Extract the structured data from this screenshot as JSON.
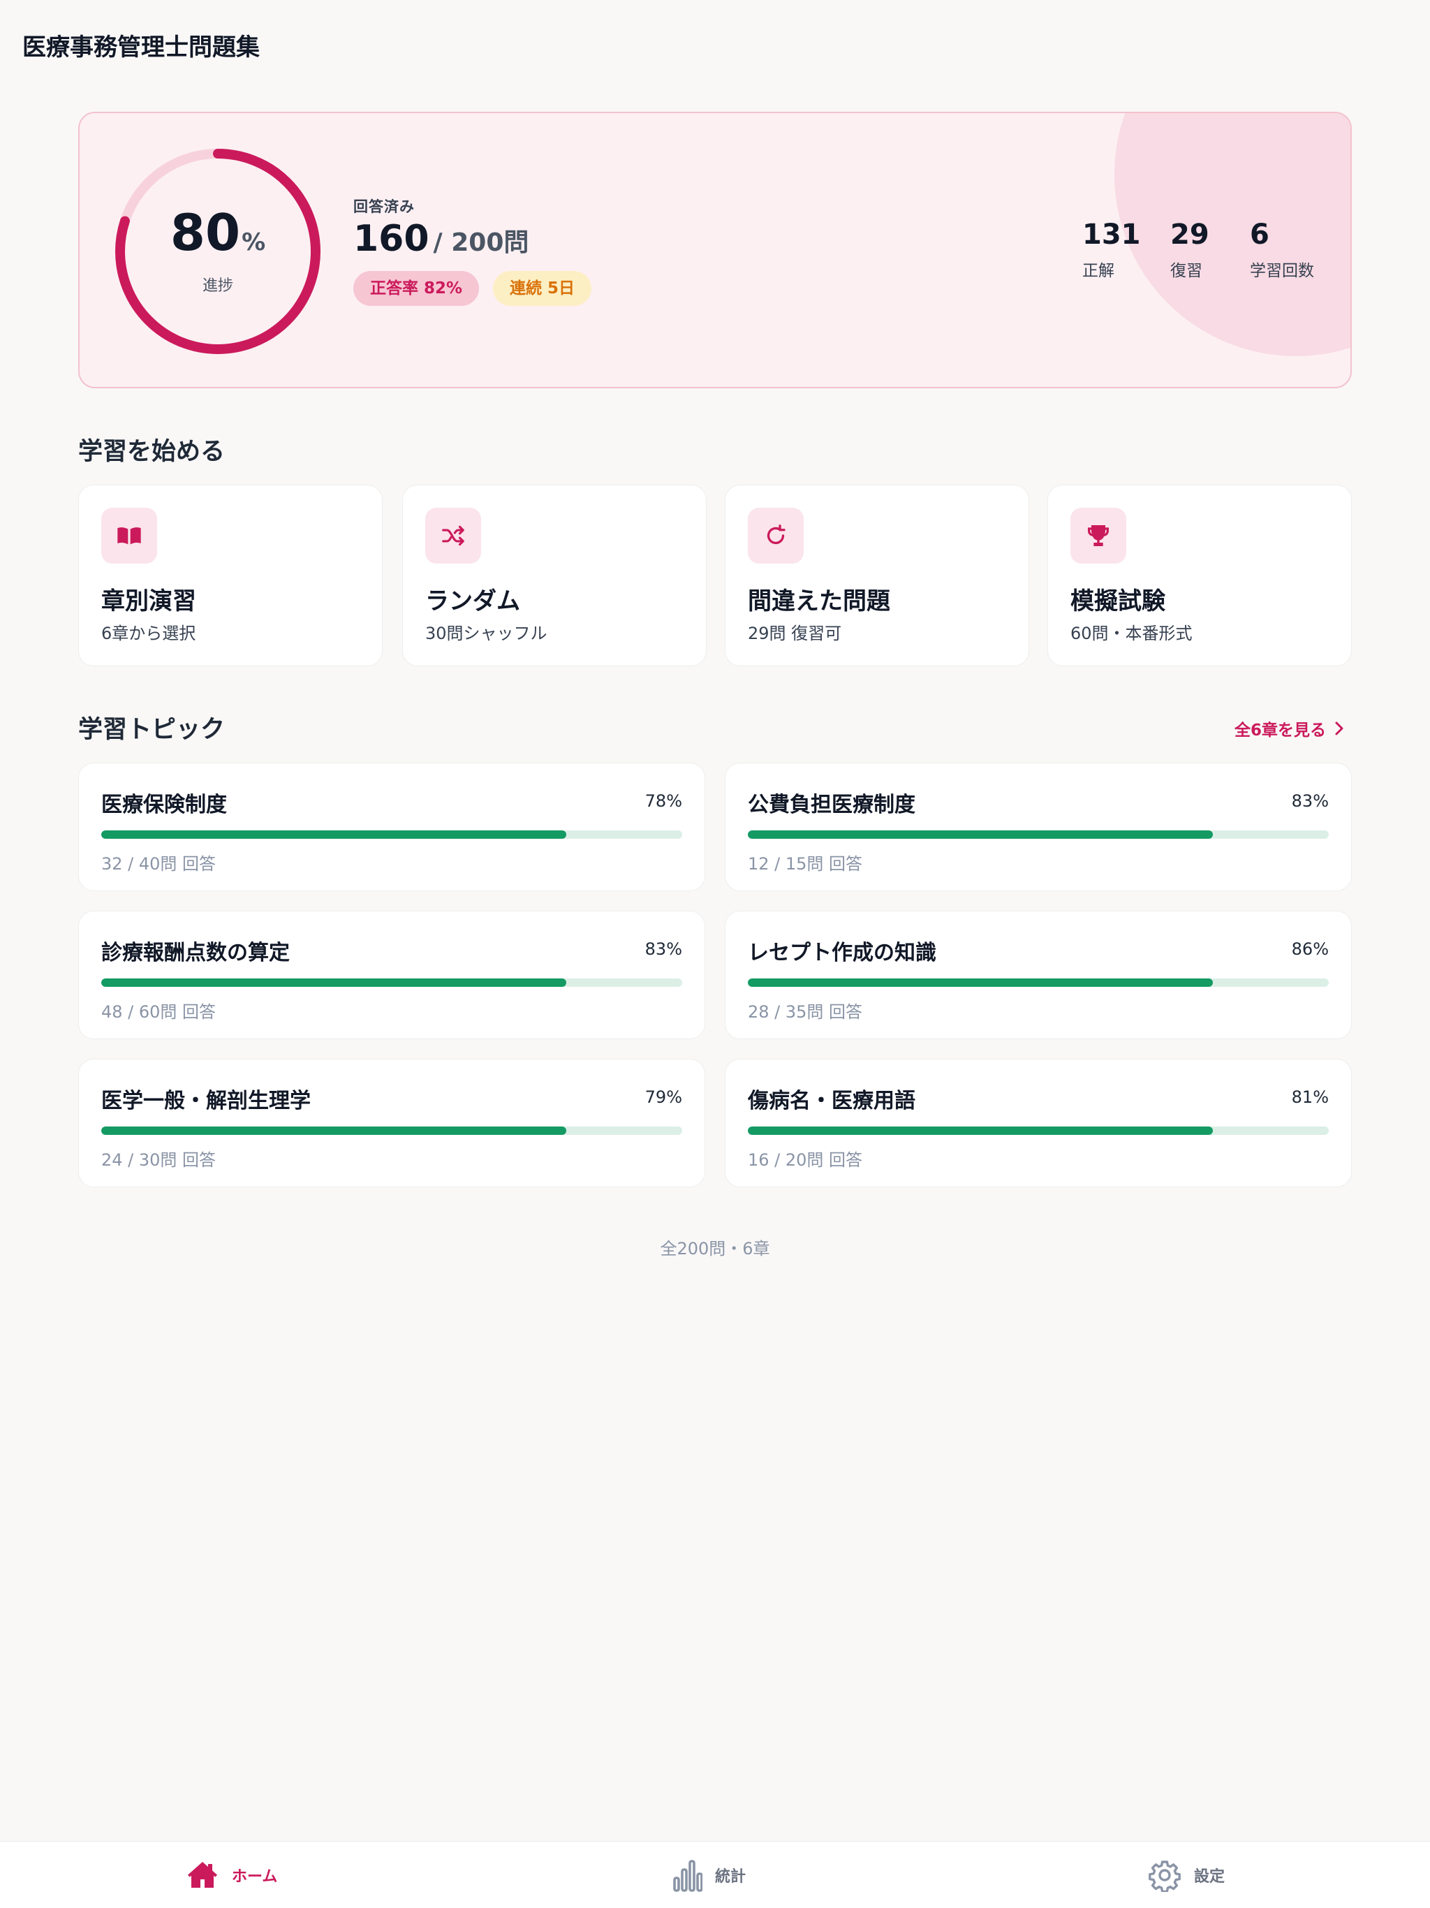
{
  "app": {
    "title": "医療事務管理士問題集"
  },
  "progress": {
    "percent": 80,
    "percent_value": "80",
    "percent_unit": "%",
    "label": "進捗",
    "answered_label": "回答済み",
    "answered": "160",
    "total": "/ 200問",
    "accuracy_chip": "正答率 82%",
    "streak_chip": "連続 5日",
    "stats": [
      {
        "value": "131",
        "label": "正解"
      },
      {
        "value": "29",
        "label": "復習"
      },
      {
        "value": "6",
        "label": "学習回数"
      }
    ]
  },
  "start_section": {
    "title": "学習を始める",
    "actions": [
      {
        "title": "章別演習",
        "subtitle": "6章から選択",
        "icon": "book-icon"
      },
      {
        "title": "ランダム",
        "subtitle": "30問シャッフル",
        "icon": "shuffle-icon"
      },
      {
        "title": "間違えた問題",
        "subtitle": "29問 復習可",
        "icon": "retry-icon"
      },
      {
        "title": "模擬試験",
        "subtitle": "60問・本番形式",
        "icon": "trophy-icon"
      }
    ]
  },
  "topics_section": {
    "title": "学習トピック",
    "see_all": "全6章を見る",
    "topics": [
      {
        "name": "医療保険制度",
        "percent_label": "78%",
        "progress": 0.8,
        "count": "32 / 40問 回答"
      },
      {
        "name": "公費負担医療制度",
        "percent_label": "83%",
        "progress": 0.8,
        "count": "12 / 15問 回答"
      },
      {
        "name": "診療報酬点数の算定",
        "percent_label": "83%",
        "progress": 0.8,
        "count": "48 / 60問 回答"
      },
      {
        "name": "レセプト作成の知識",
        "percent_label": "86%",
        "progress": 0.8,
        "count": "28 / 35問 回答"
      },
      {
        "name": "医学一般・解剖生理学",
        "percent_label": "79%",
        "progress": 0.8,
        "count": "24 / 30問 回答"
      },
      {
        "name": "傷病名・医療用語",
        "percent_label": "81%",
        "progress": 0.8,
        "count": "16 / 20問 回答"
      }
    ],
    "footer": "全200問・6章"
  },
  "tabbar": {
    "tabs": [
      {
        "label": "ホーム",
        "icon": "home-icon",
        "active": true
      },
      {
        "label": "統計",
        "icon": "stats-icon",
        "active": false
      },
      {
        "label": "設定",
        "icon": "gear-icon",
        "active": false
      }
    ]
  },
  "colors": {
    "accent": "#cb1a5b",
    "accent_soft": "#fbe4eb",
    "progress_green": "#149a63",
    "streak": "#d9720a"
  }
}
